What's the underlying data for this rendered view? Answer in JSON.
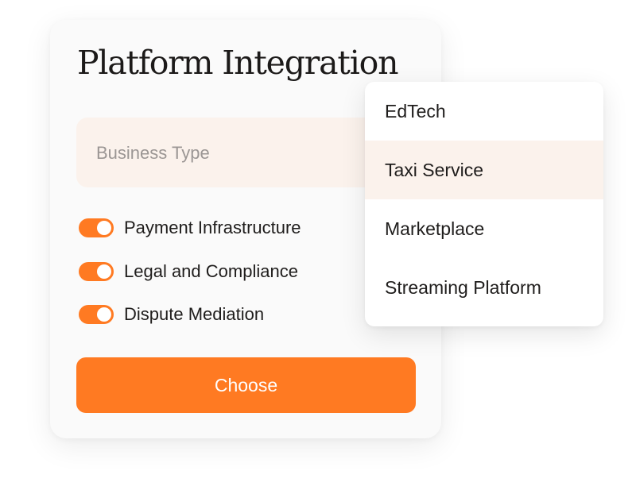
{
  "card": {
    "title": "Platform Integration"
  },
  "business_type": {
    "placeholder": "Business Type"
  },
  "toggles": [
    {
      "label": "Payment Infrastructure",
      "on": true
    },
    {
      "label": "Legal and Compliance",
      "on": true
    },
    {
      "label": "Dispute Mediation",
      "on": true
    }
  ],
  "choose_button": {
    "label": "Choose"
  },
  "dropdown": {
    "options": [
      {
        "label": "EdTech"
      },
      {
        "label": "Taxi Service"
      },
      {
        "label": "Marketplace"
      },
      {
        "label": "Streaming Platform"
      }
    ],
    "highlighted": "Taxi Service"
  },
  "colors": {
    "accent": "#ff7a22",
    "field_background": "#fbf2ec",
    "card_background": "#fafafa",
    "text": "#1f1d1c",
    "placeholder": "#9b9694"
  }
}
